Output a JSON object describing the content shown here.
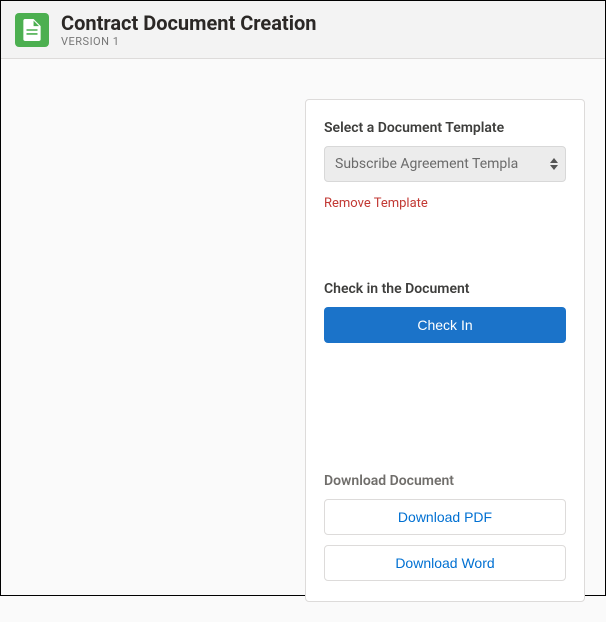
{
  "header": {
    "title": "Contract Document Creation",
    "subtitle": "Version 1"
  },
  "panel": {
    "template_section": {
      "label": "Select a Document Template",
      "selected_value": "Subscribe Agreement Templa",
      "remove_label": "Remove Template"
    },
    "checkin_section": {
      "label": "Check in the Document",
      "button_label": "Check In"
    },
    "download_section": {
      "label": "Download Document",
      "pdf_button": "Download PDF",
      "word_button": "Download Word"
    }
  },
  "colors": {
    "primary_button": "#1b73c9",
    "link_danger": "#c23934",
    "link_brand": "#0070d2",
    "icon_bg": "#4CAF50"
  }
}
